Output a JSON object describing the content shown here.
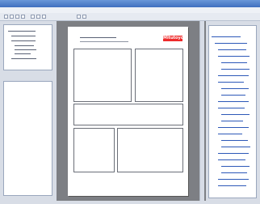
{
  "window": {
    "title": ""
  },
  "menubar": {
    "items": [
      "",
      "",
      "",
      "",
      "",
      "",
      ""
    ]
  },
  "toolbar": {
    "buttons": [
      "new-icon",
      "open-icon",
      "save-icon",
      "print-icon",
      "cut-icon",
      "copy-icon",
      "paste-icon",
      "zoom-icon",
      "settings-icon"
    ]
  },
  "document": {
    "header_title": "",
    "logo_text": "Mitutoyo"
  },
  "colors": {
    "accent": "#3d6fc7",
    "logo": "#ee2b2b",
    "workspace": "#7d7f84",
    "window_bg": "#d8dde6"
  }
}
